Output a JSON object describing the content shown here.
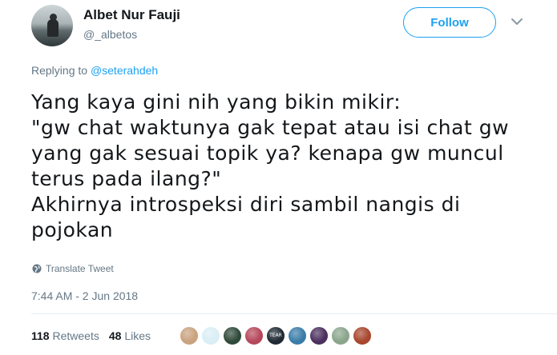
{
  "author": {
    "name": "Albet Nur Fauji",
    "handle": "@_albetos"
  },
  "follow_label": "Follow",
  "replying": {
    "prefix": "Replying to ",
    "mention": "@seterahdeh"
  },
  "tweet_lines": [
    "Yang kaya gini nih yang bikin mikir:",
    "\"gw chat waktunya gak tepat atau isi chat gw",
    "yang gak sesuai topik ya? kenapa gw muncul",
    "terus pada ilang?\"",
    "Akhirnya introspeksi diri sambil nangis di",
    "pojokan"
  ],
  "translate_label": "Translate Tweet",
  "timestamp": "7:44 AM - 2 Jun 2018",
  "stats": {
    "retweets_count": "118",
    "retweets_label": "Retweets",
    "likes_count": "48",
    "likes_label": "Likes"
  },
  "likers": [
    {
      "color": "#c9a27e"
    },
    {
      "color": "#d9eef5"
    },
    {
      "color": "#2f4a3a"
    },
    {
      "color": "#b5475a"
    },
    {
      "color": "#1f2a33",
      "text": "TEAR"
    },
    {
      "color": "#3a7ca8"
    },
    {
      "color": "#4b2f5e"
    },
    {
      "color": "#8aa58b"
    },
    {
      "color": "#a8462e"
    }
  ],
  "colors": {
    "accent": "#1da1f2",
    "muted": "#657786",
    "text": "#14171a"
  }
}
